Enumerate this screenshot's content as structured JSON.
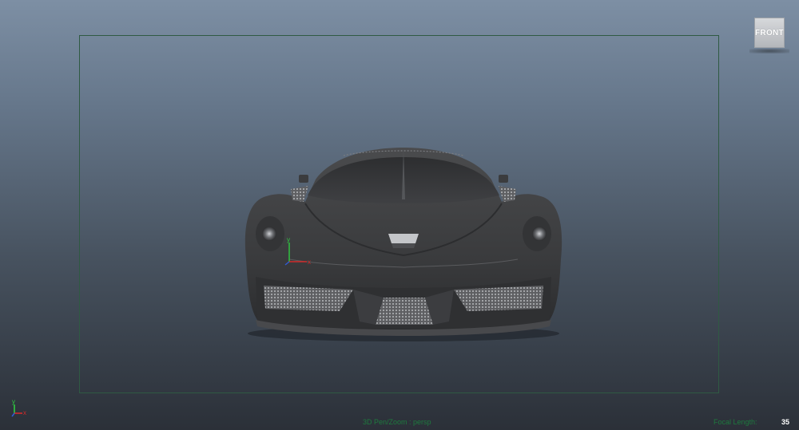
{
  "viewport": {
    "camera_label": "3D Pen/Zoom : persp",
    "focal_length_label": "Focal Length:",
    "focal_length_value": "35",
    "background_top": "#7d8fa4",
    "background_bottom": "#2b3038",
    "gate_color": "#2f5a43",
    "hud_color": "#1e7a3e"
  },
  "viewcube": {
    "face_label": "FRONT"
  },
  "axes": {
    "x_label": "x",
    "y_label": "y",
    "x_color": "#d12a2a",
    "y_color": "#2ecc40",
    "z_color": "#2f5bd6"
  },
  "icons": {
    "car": "car-model-icon",
    "viewcube": "viewcube-icon",
    "world_axis": "world-axis-icon",
    "origin_axis": "origin-axis-icon"
  }
}
